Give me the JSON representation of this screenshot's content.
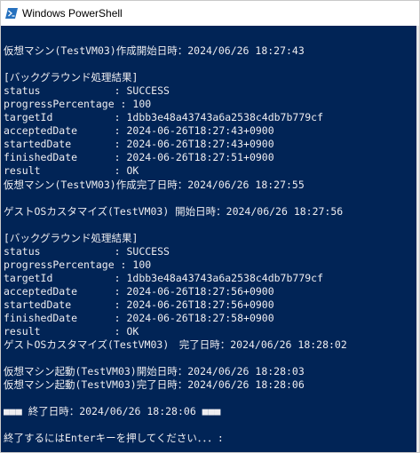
{
  "window": {
    "title": "Windows PowerShell",
    "icon": "powershell-icon"
  },
  "colors": {
    "console_background": "#012456",
    "console_text": "#eeedf0"
  },
  "console": {
    "lines": [
      "",
      "仮想マシン(TestVM03)作成開始日時：2024/06/26 18:27:43",
      "",
      "[バックグラウンド処理結果]",
      "status            : SUCCESS",
      "progressPercentage : 100",
      "targetId          : 1dbb3e48a43743a6a2538c4db7b779cf",
      "acceptedDate      : 2024-06-26T18:27:43+0900",
      "startedDate       : 2024-06-26T18:27:43+0900",
      "finishedDate      : 2024-06-26T18:27:51+0900",
      "result            : OK",
      "仮想マシン(TestVM03)作成完了日時：2024/06/26 18:27:55",
      "",
      "ゲストOSカスタマイズ(TestVM03) 開始日時：2024/06/26 18:27:56",
      "",
      "[バックグラウンド処理結果]",
      "status            : SUCCESS",
      "progressPercentage : 100",
      "targetId          : 1dbb3e48a43743a6a2538c4db7b779cf",
      "acceptedDate      : 2024-06-26T18:27:56+0900",
      "startedDate       : 2024-06-26T18:27:56+0900",
      "finishedDate      : 2024-06-26T18:27:58+0900",
      "result            : OK",
      "ゲストOSカスタマイズ(TestVM03)　完了日時：2024/06/26 18:28:02",
      "",
      "仮想マシン起動(TestVM03)開始日時：2024/06/26 18:28:03",
      "仮想マシン起動(TestVM03)完了日時：2024/06/26 18:28:06",
      "",
      "■■■ 終了日時：2024/06/26 18:28:06 ■■■",
      "",
      "終了するにはEnterキーを押してください．．．:"
    ]
  }
}
